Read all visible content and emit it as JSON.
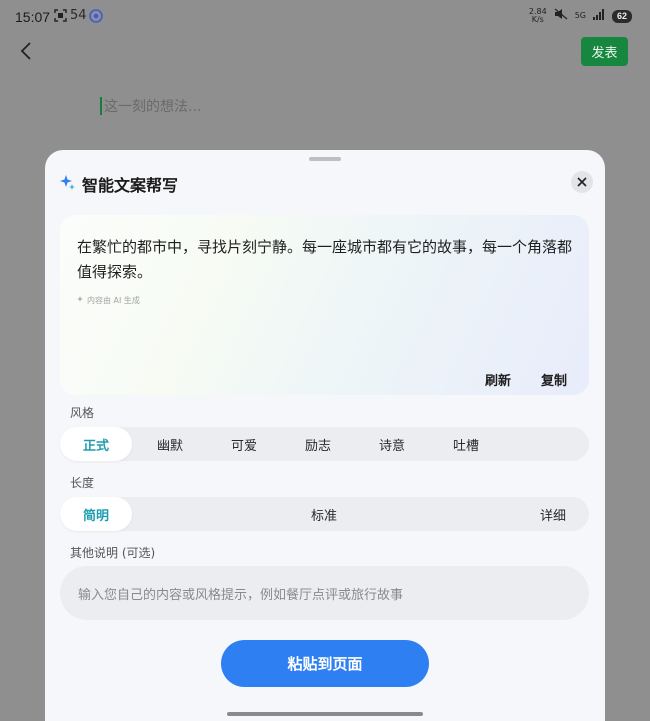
{
  "statusbar": {
    "time": "15:07",
    "icons": [
      "scan-icon",
      "sim-54-icon",
      "chrome-icon"
    ],
    "sim_label": "54",
    "net_speed": "2.84",
    "net_unit": "K/s",
    "signal_label": "5G",
    "battery": "62"
  },
  "topbar": {
    "publish_label": "发表",
    "input_placeholder": "这一刻的想法..."
  },
  "sheet": {
    "title": "智能文案帮写",
    "result": {
      "text": "在繁忙的都市中，寻找片刻宁静。每一座城市都有它的故事，每一个角落都值得探索。",
      "ai_note": "内容由 AI 生成",
      "refresh_label": "刷新",
      "copy_label": "复制"
    },
    "style": {
      "label": "风格",
      "options": [
        "正式",
        "幽默",
        "可爱",
        "励志",
        "诗意",
        "吐槽"
      ],
      "selected": "正式"
    },
    "length": {
      "label": "长度",
      "options": [
        "简明",
        "标准",
        "详细"
      ],
      "selected": "简明"
    },
    "extra": {
      "label": "其他说明 (可选)",
      "placeholder": "输入您自己的内容或风格提示，例如餐厅点评或旅行故事"
    },
    "paste_label": "粘贴到页面"
  },
  "colors": {
    "publish": "#17863f",
    "accent": "#1e9fb0",
    "primary_button": "#2d7ff2"
  }
}
